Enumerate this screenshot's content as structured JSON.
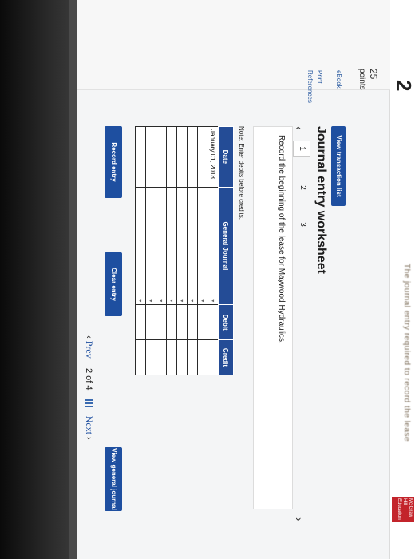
{
  "header": {
    "question_number": "2",
    "blurred_text": "The journal entry required to record the lease"
  },
  "sidebar": {
    "points_value": "25",
    "points_label": "points",
    "items": [
      {
        "label": "eBook"
      },
      {
        "label": "Print"
      },
      {
        "label": "References"
      }
    ]
  },
  "view_transaction_list_label": "View transaction list",
  "title": "Journal entry worksheet",
  "steps": [
    "1",
    "2",
    "3"
  ],
  "nav": {
    "prev_arrow": "‹",
    "next_arrow": "›"
  },
  "instruction": "Record the beginning of the lease for Maywood Hydraulics.",
  "note": "Note: Enter debits before credits.",
  "table": {
    "headers": [
      "Date",
      "General Journal",
      "Debit",
      "Credit"
    ],
    "rows": [
      {
        "date": "January 01, 2018"
      },
      {
        "date": ""
      },
      {
        "date": ""
      },
      {
        "date": ""
      },
      {
        "date": ""
      },
      {
        "date": ""
      },
      {
        "date": ""
      },
      {
        "date": ""
      }
    ]
  },
  "buttons": {
    "record": "Record entry",
    "clear": "Clear entry",
    "view_journal": "View general journal"
  },
  "pager": {
    "prev": "Prev",
    "current": "2",
    "of": "of",
    "total": "4",
    "next": "Next"
  },
  "logo": {
    "text": "Mc Graw Hill Education"
  },
  "colors": {
    "accent": "#1e4fa0",
    "table_header": "#244c96",
    "logo": "#c3242b"
  }
}
